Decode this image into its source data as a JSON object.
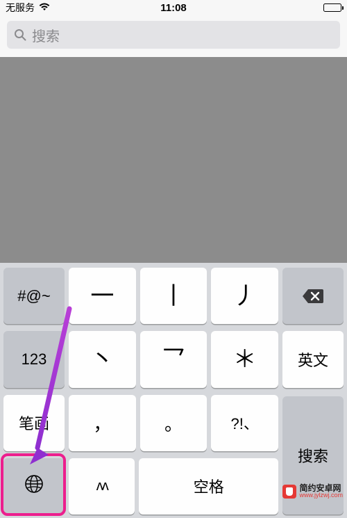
{
  "status": {
    "carrier": "无服务",
    "time": "11:08"
  },
  "search": {
    "placeholder": "搜索"
  },
  "keyboard": {
    "row1": {
      "symbols": "#@~",
      "stroke_heng": "一",
      "stroke_shu": "丨",
      "stroke_pie": "丿"
    },
    "row2": {
      "numbers": "123",
      "stroke_dian": "丶",
      "stroke_gou": "乛",
      "wildcard": "＊",
      "english": "英文"
    },
    "row3": {
      "bihua": "笔画",
      "comma": "，",
      "period": "。",
      "punct": "?!、"
    },
    "row4": {
      "emoji": "^^",
      "space": "空格",
      "search": "搜索"
    }
  },
  "watermark": {
    "title": "简约安卓网",
    "url": "www.jylzwj.com"
  },
  "annotation": {
    "arrow_color": "#b83fd6",
    "highlight_color": "#ec1e8d"
  }
}
